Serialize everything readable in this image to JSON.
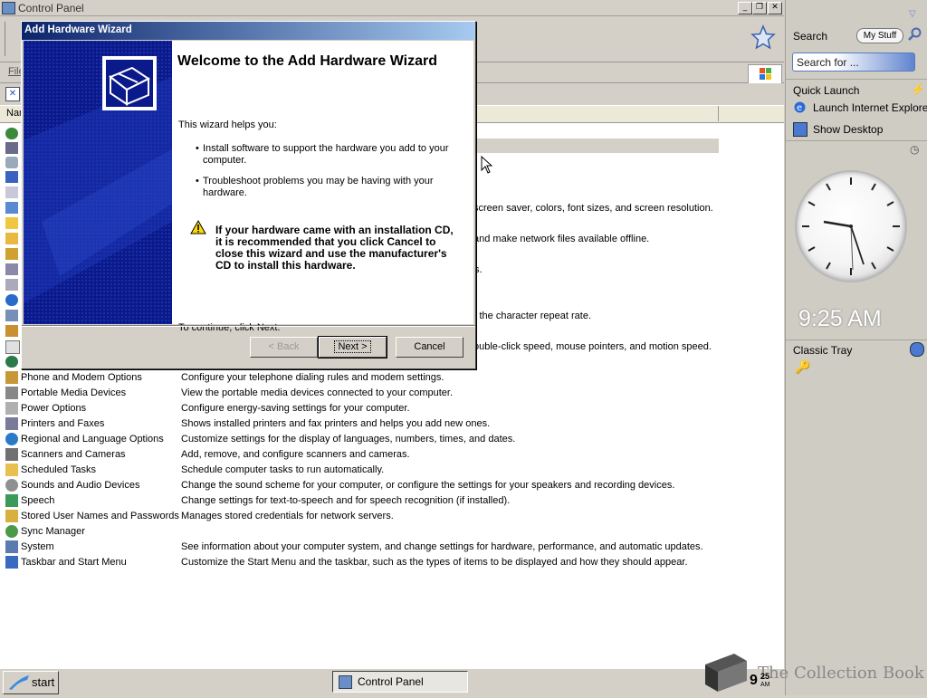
{
  "window": {
    "title": "Control Panel"
  },
  "menu": {
    "file": "File"
  },
  "columns": {
    "name": "Nar"
  },
  "wizard": {
    "title": "Add Hardware Wizard",
    "heading": "Welcome to the Add Hardware Wizard",
    "intro": "This wizard helps you:",
    "bullet1_line1": "Install software to support the hardware you add to your",
    "bullet1_line2": "computer.",
    "bullet2_line1": "Troubleshoot problems you may be having with your",
    "bullet2_line2": "hardware.",
    "warning_line1": "If your hardware came with an installation CD,",
    "warning_line2": "it is recommended that you click Cancel to",
    "warning_line3": "close this wizard and use the manufacturer's",
    "warning_line4": "CD to install this hardware.",
    "continue": "To continue, click Next.",
    "back_label": "< Back",
    "next_label": "Next >",
    "cancel_label": "Cancel"
  },
  "visible_fragments": [
    "screen saver, colors, font sizes, and screen resolution.",
    "and make network files available offline.",
    "s.",
    "l the character repeat rate.",
    "ouble-click speed, mouse pointers, and motion speed."
  ],
  "items": [
    {
      "name": "Phone and Modem Options",
      "desc": "Configure your telephone dialing rules and modem settings.",
      "icon": "phone-icon"
    },
    {
      "name": "Portable Media Devices",
      "desc": "View the portable media devices connected to your computer.",
      "icon": "media-device-icon"
    },
    {
      "name": "Power Options",
      "desc": "Configure energy-saving settings for your computer.",
      "icon": "power-icon"
    },
    {
      "name": "Printers and Faxes",
      "desc": "Shows installed printers and fax printers and helps you add new ones.",
      "icon": "printer-icon"
    },
    {
      "name": "Regional and Language Options",
      "desc": "Customize settings for the display of languages, numbers, times, and dates.",
      "icon": "globe-icon"
    },
    {
      "name": "Scanners and Cameras",
      "desc": "Add, remove, and configure scanners and cameras.",
      "icon": "scanner-icon"
    },
    {
      "name": "Scheduled Tasks",
      "desc": "Schedule computer tasks to run automatically.",
      "icon": "folder-clock-icon"
    },
    {
      "name": "Sounds and Audio Devices",
      "desc": "Change the sound scheme for your computer, or configure the settings for your speakers and recording devices.",
      "icon": "speaker-icon"
    },
    {
      "name": "Speech",
      "desc": "Change settings for text-to-speech and for speech recognition (if installed).",
      "icon": "speech-icon"
    },
    {
      "name": "Stored User Names and Passwords",
      "desc": "Manages stored credentials for network servers.",
      "icon": "keys-icon"
    },
    {
      "name": "Sync Manager",
      "desc": "",
      "icon": "sync-icon"
    },
    {
      "name": "System",
      "desc": "See information about your computer system, and change settings for hardware, performance, and automatic updates.",
      "icon": "computer-icon"
    },
    {
      "name": "Taskbar and Start Menu",
      "desc": "Customize the Start Menu and the taskbar, such as the types of items to be displayed and how they should appear.",
      "icon": "taskbar-icon"
    }
  ],
  "sidebar": {
    "search_label": "Search",
    "mystuff_label": "My Stuff",
    "search_placeholder": "Search for ...",
    "quick_launch": "Quick Launch",
    "ql_item1": "Launch Internet Explore",
    "ql_item2": "Show Desktop",
    "clock_time": "9:25 AM",
    "classic_tray": "Classic Tray"
  },
  "taskbar": {
    "start": "start",
    "task_item": "Control Panel",
    "clock_hour": "9",
    "clock_min": "25",
    "clock_ampm": "AM"
  },
  "watermark": "The Collection Book",
  "colors": {
    "title_active": "#0a246a",
    "wizard_panel": "#0b1a8a",
    "sidebar_bg": "#cfccc4"
  }
}
